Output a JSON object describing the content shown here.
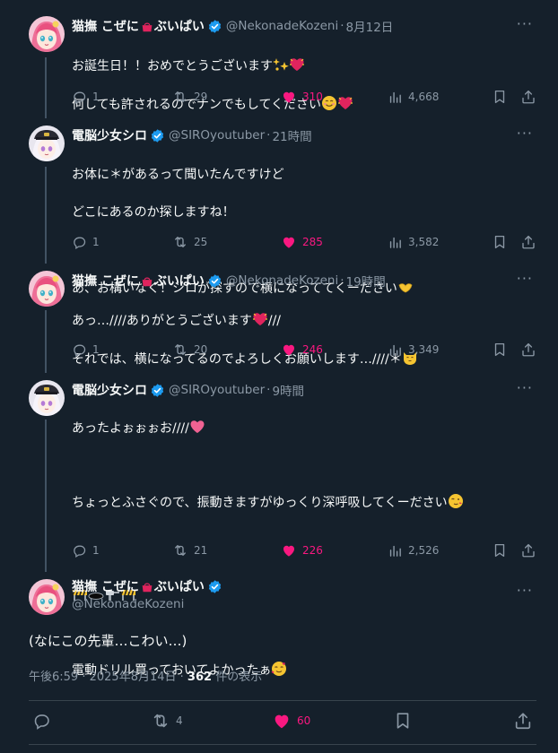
{
  "tweets": [
    {
      "name": "猫撫 こぜに",
      "name_suffix": "ぶいぱい",
      "handle": "@NekonadeKozeni",
      "time": "8月12日",
      "text": "お誕生日！！おめでとうございます",
      "text_line2": "何しても許されるのでナンでもしてください",
      "replies": "1",
      "retweets": "29",
      "likes": "310",
      "views": "4,668"
    },
    {
      "name": "電脳少女シロ",
      "handle": "@SIROyoutuber",
      "time": "21時間",
      "text_lines": [
        "お体に＊があるって聞いたんですけど",
        "どこにあるのか探しますね！",
        "",
        "あ、お構いなく！シロが探すので横になっててくーださい"
      ],
      "replies": "1",
      "retweets": "25",
      "likes": "285",
      "views": "3,582"
    },
    {
      "name": "猫撫 こぜに",
      "name_suffix": "ぶいぱい",
      "handle": "@NekonadeKozeni",
      "time": "19時間",
      "text_line1": "あっ…////ありがとうございます",
      "text_line1_end": "///",
      "text_line2": "それでは、横になってるのでよろしくお願いします…////＊",
      "replies": "1",
      "retweets": "20",
      "likes": "246",
      "views": "3,349"
    },
    {
      "name": "電脳少女シロ",
      "handle": "@SIROyoutuber",
      "time": "9時間",
      "text_line1": "あったよぉぉぉお////",
      "text_line2": "ちょっとふさぐので、振動きますがゆっくり深呼吸してくーださい",
      "text_line4": "電動ドリル買っておいてよかったぁ",
      "replies": "1",
      "retweets": "21",
      "likes": "226",
      "views": "2,526"
    }
  ],
  "main": {
    "name": "猫撫 こぜに",
    "name_suffix": "ぶいぱい",
    "handle": "@NekonadeKozeni",
    "text": "(なにこの先輩…こわい…)",
    "time": "午後6:59",
    "date": "2025年8月14日",
    "views_count": "362",
    "views_label": "件の表示",
    "retweets": "4",
    "likes": "60"
  },
  "icons": [
    "reply-icon",
    "retweet-icon",
    "heart-icon",
    "views-icon",
    "bookmark-icon",
    "share-icon",
    "more-icon",
    "verified-icon"
  ],
  "colors": {
    "background": "#15202b",
    "text": "#f7f9f9",
    "muted": "#8b98a5",
    "like": "#f91880",
    "verified": "#1d9bf0",
    "thread_line": "#425364"
  }
}
